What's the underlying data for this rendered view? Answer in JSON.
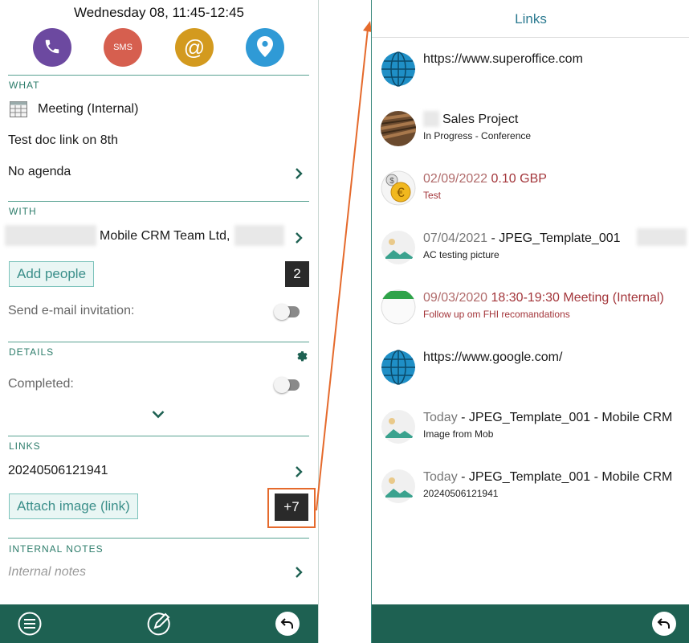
{
  "left": {
    "date_time": "Wednesday 08, 11:45-12:45",
    "actions": [
      {
        "name": "phone",
        "label": "",
        "color": "#6c49a0"
      },
      {
        "name": "sms",
        "label": "SMS",
        "color": "#d65f4f"
      },
      {
        "name": "email",
        "label": "@",
        "color": "#d39a1f"
      },
      {
        "name": "location",
        "label": "",
        "color": "#2f9ad6"
      }
    ],
    "what": {
      "heading": "WHAT",
      "type": "Meeting (Internal)",
      "title": "Test doc link on 8th",
      "agenda": "No agenda"
    },
    "with": {
      "heading": "WITH",
      "company": "Mobile CRM Team Ltd,",
      "add_people": "Add people",
      "people_count": "2",
      "send_invitation": "Send e-mail invitation:"
    },
    "details": {
      "heading": "DETAILS",
      "completed": "Completed:"
    },
    "links": {
      "heading": "LINKS",
      "first_link": "20240506121941",
      "attach_image": "Attach image (link)",
      "more_count": "+7"
    },
    "notes": {
      "heading": "INTERNAL NOTES",
      "placeholder": "Internal notes"
    }
  },
  "right": {
    "title": "Links",
    "items": [
      {
        "icon": "globe-icon",
        "prefix": "",
        "main": "https://www.superoffice.com",
        "sub": ""
      },
      {
        "icon": "sale-image",
        "prefix": "",
        "main": "Sales Project",
        "sub": "In Progress  -  Conference"
      },
      {
        "icon": "expense-icon",
        "prefix": "02/09/2022",
        "main": "0.10 GBP",
        "sub": "Test"
      },
      {
        "icon": "image-placeholder-icon",
        "prefix": "07/04/2021",
        "main": "- JPEG_Template_001",
        "sub": "AC testing picture"
      },
      {
        "icon": "calendar-icon",
        "prefix": "09/03/2020",
        "main": "18:30-19:30 Meeting (Internal)",
        "sub": "Follow up om FHI recomandations"
      },
      {
        "icon": "globe-icon",
        "prefix": "",
        "main": "https://www.google.com/",
        "sub": ""
      },
      {
        "icon": "image-placeholder-icon",
        "prefix": "Today",
        "main": "- JPEG_Template_001 - Mobile CRM",
        "sub": "Image from Mob"
      },
      {
        "icon": "image-placeholder-icon",
        "prefix": "Today",
        "main": "- JPEG_Template_001 - Mobile CRM",
        "sub": "20240506121941"
      }
    ]
  },
  "colors": {
    "teal": "#1e6152",
    "section": "#2c7c6a",
    "annotation": "#e56a2c",
    "red_text": "#a3353a"
  }
}
